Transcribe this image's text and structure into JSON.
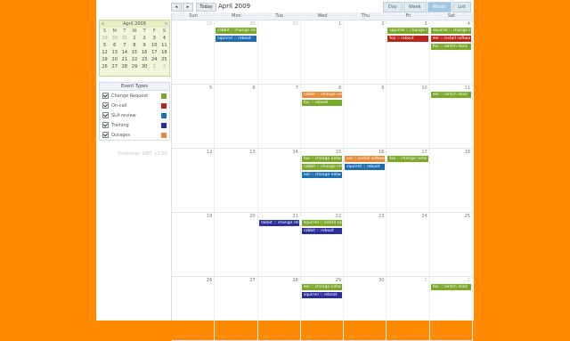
{
  "colors": {
    "background": "#ff8a00",
    "change_request": "#7aa82a",
    "on_call": "#b8261b",
    "sla_review": "#1f6fb0",
    "training": "#2b2f9e",
    "outages": "#e88a3c"
  },
  "mini_calendar": {
    "title": "April 2009",
    "prev_icon": "«",
    "next_icon": "»",
    "weekdays": [
      "S",
      "M",
      "T",
      "W",
      "T",
      "F",
      "S"
    ],
    "days": [
      {
        "n": "29",
        "dim": true
      },
      {
        "n": "30",
        "dim": true
      },
      {
        "n": "31",
        "dim": true
      },
      {
        "n": "1"
      },
      {
        "n": "2"
      },
      {
        "n": "3"
      },
      {
        "n": "4"
      },
      {
        "n": "5"
      },
      {
        "n": "6"
      },
      {
        "n": "7"
      },
      {
        "n": "8"
      },
      {
        "n": "9"
      },
      {
        "n": "10"
      },
      {
        "n": "11"
      },
      {
        "n": "12"
      },
      {
        "n": "13"
      },
      {
        "n": "14"
      },
      {
        "n": "15"
      },
      {
        "n": "16"
      },
      {
        "n": "17"
      },
      {
        "n": "18"
      },
      {
        "n": "19"
      },
      {
        "n": "20"
      },
      {
        "n": "21"
      },
      {
        "n": "22"
      },
      {
        "n": "23"
      },
      {
        "n": "24"
      },
      {
        "n": "25"
      },
      {
        "n": "26"
      },
      {
        "n": "27"
      },
      {
        "n": "28"
      },
      {
        "n": "29"
      },
      {
        "n": "30"
      },
      {
        "n": "1",
        "dim": true
      },
      {
        "n": "2",
        "dim": true
      }
    ]
  },
  "event_types": {
    "title": "Event Types",
    "items": [
      {
        "label": "Change Request",
        "color": "#7aa82a"
      },
      {
        "label": "On-call",
        "color": "#b8261b"
      },
      {
        "label": "SLA review",
        "color": "#1f6fb0"
      },
      {
        "label": "Training",
        "color": "#2b2f9e"
      },
      {
        "label": "Outages",
        "color": "#e88a3c"
      }
    ]
  },
  "timezone": "Timezone: GMT +1:00",
  "toolbar": {
    "prev_icon": "◂",
    "next_icon": "▸",
    "today_label": "Today",
    "title": "April 2009",
    "views": [
      {
        "label": "Day",
        "active": false
      },
      {
        "label": "Week",
        "active": false
      },
      {
        "label": "Month",
        "active": true
      },
      {
        "label": "List",
        "active": false
      }
    ]
  },
  "calendar": {
    "weekdays": [
      "Sun",
      "Mon",
      "Tue",
      "Wed",
      "Thu",
      "Fri",
      "Sat"
    ],
    "weeks": [
      {
        "days": [
          {
            "n": "29",
            "other": true,
            "events": []
          },
          {
            "n": "30",
            "other": true,
            "events": [
              {
                "text": "rabbit :: change rel",
                "color": "#7aa82a"
              },
              {
                "text": "squirrel :: reboot",
                "color": "#1f6fb0"
              }
            ]
          },
          {
            "n": "31",
            "other": true,
            "events": []
          },
          {
            "n": "1",
            "events": []
          },
          {
            "n": "2",
            "events": []
          },
          {
            "n": "3",
            "events": [
              {
                "text": "squirrel :: change r",
                "color": "#7aa82a"
              },
              {
                "text": "fox :: reboot",
                "color": "#b8261b"
              }
            ]
          },
          {
            "n": "4",
            "events": [
              {
                "text": "squirrel :: change r",
                "color": "#7aa82a"
              },
              {
                "text": "eel :: install softwa",
                "color": "#b8261b"
              },
              {
                "text": "fox :: switch dock",
                "color": "#7aa82a"
              }
            ]
          }
        ]
      },
      {
        "days": [
          {
            "n": "5",
            "events": []
          },
          {
            "n": "6",
            "events": []
          },
          {
            "n": "7",
            "events": []
          },
          {
            "n": "8",
            "events": [
              {
                "text": "rabbit :: change rel",
                "color": "#e88a3c"
              },
              {
                "text": "fox :: reboot",
                "color": "#7aa82a"
              }
            ]
          },
          {
            "n": "9",
            "events": []
          },
          {
            "n": "10",
            "events": []
          },
          {
            "n": "11",
            "events": [
              {
                "text": "eel :: switch dock",
                "color": "#7aa82a"
              }
            ]
          }
        ]
      },
      {
        "days": [
          {
            "n": "12",
            "events": []
          },
          {
            "n": "13",
            "events": []
          },
          {
            "n": "14",
            "events": []
          },
          {
            "n": "15",
            "events": [
              {
                "text": "fox :: change netw",
                "color": "#7aa82a"
              },
              {
                "text": "rabbit :: change rel",
                "color": "#7aa82a"
              },
              {
                "text": "eel :: change netw",
                "color": "#1f6fb0"
              }
            ]
          },
          {
            "n": "16",
            "events": [
              {
                "text": "eel :: install softwa",
                "color": "#e88a3c"
              },
              {
                "text": "squirrel :: reboot",
                "color": "#1f6fb0"
              }
            ]
          },
          {
            "n": "17",
            "events": [
              {
                "text": "fox :: change netw",
                "color": "#7aa82a"
              }
            ]
          },
          {
            "n": "18",
            "events": []
          }
        ]
      },
      {
        "days": [
          {
            "n": "19",
            "events": []
          },
          {
            "n": "20",
            "events": []
          },
          {
            "n": "21",
            "events": [
              {
                "text": "rabbit :: change rel",
                "color": "#2b2f9e"
              }
            ]
          },
          {
            "n": "22",
            "events": [
              {
                "text": "squirrel :: install so",
                "color": "#7aa82a"
              },
              {
                "text": "rabbit :: reboot",
                "color": "#2b2f9e"
              }
            ]
          },
          {
            "n": "23",
            "events": []
          },
          {
            "n": "24",
            "events": []
          },
          {
            "n": "25",
            "events": []
          }
        ]
      },
      {
        "days": [
          {
            "n": "26",
            "events": []
          },
          {
            "n": "27",
            "events": []
          },
          {
            "n": "28",
            "events": []
          },
          {
            "n": "29",
            "events": [
              {
                "text": "eel :: change netw",
                "color": "#7aa82a"
              },
              {
                "text": "squirrel :: reboot",
                "color": "#2b2f9e"
              }
            ]
          },
          {
            "n": "30",
            "events": []
          },
          {
            "n": "1",
            "other": true,
            "events": []
          },
          {
            "n": "2",
            "other": true,
            "events": [
              {
                "text": "fox :: switch dock",
                "color": "#7aa82a"
              }
            ]
          }
        ]
      }
    ]
  }
}
